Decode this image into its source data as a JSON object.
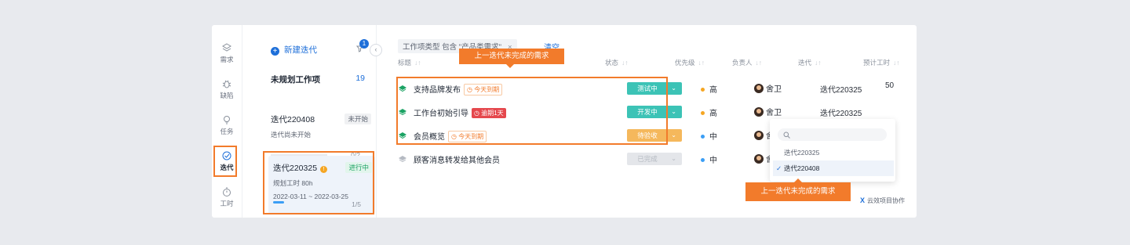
{
  "rail": [
    {
      "label": "需求",
      "icon": "layers-icon"
    },
    {
      "label": "缺陷",
      "icon": "bug-icon"
    },
    {
      "label": "任务",
      "icon": "lightbulb-icon"
    },
    {
      "label": "迭代",
      "icon": "iteration-icon",
      "active": true
    },
    {
      "label": "工时",
      "icon": "stopwatch-icon"
    }
  ],
  "iterations_panel": {
    "new_label": "新建迭代",
    "filter_badge": "1",
    "collapse_glyph": "‹",
    "unplanned_label": "未规划工作项",
    "unplanned_count": "19",
    "iter1": {
      "name": "迭代220408",
      "status": "未开始",
      "sub": "迭代尚未开始",
      "progress": "0/2"
    },
    "iter2": {
      "name": "迭代220325",
      "warn": "!",
      "status": "进行中",
      "hours": "规划工时 80h",
      "dates": "2022-03-11 ~ 2022-03-25",
      "progress": "1/5"
    }
  },
  "filter": {
    "chip": "工作项类型 包含 \"产品类需求\"",
    "chip_close": "×",
    "clear": "清空"
  },
  "columns": {
    "title": "标题",
    "status": "状态",
    "priority": "优先级",
    "owner": "负责人",
    "iteration": "迭代",
    "hours": "预计工时",
    "sort": "↓↑"
  },
  "rows": [
    {
      "title": "支持品牌发布",
      "tag": "今天到期",
      "tag_type": "today",
      "status": "测试中",
      "status_color": "#3cc3b6",
      "priority": "高",
      "priority_color": "#f5a623",
      "owner": "舍卫",
      "iteration": "迭代220325",
      "hours": "50"
    },
    {
      "title": "工作台初始引导",
      "tag": "逾期1天",
      "tag_type": "overdue",
      "status": "开发中",
      "status_color": "#3cc3b6",
      "priority": "高",
      "priority_color": "#f5a623",
      "owner": "舍卫",
      "iteration": "迭代220325",
      "hours": ""
    },
    {
      "title": "会员概览",
      "tag": "今天到期",
      "tag_type": "today",
      "status": "待验收",
      "status_color": "#f5b85c",
      "priority": "中",
      "priority_color": "#3b9ef5",
      "owner": "舍卫",
      "iteration": "",
      "hours": ""
    },
    {
      "title": "顾客消息转发给其他会员",
      "tag": "",
      "tag_type": "",
      "status": "已完成",
      "status_color": "#e4e6ea",
      "priority": "中",
      "priority_color": "#3b9ef5",
      "owner": "舍卫",
      "iteration": "",
      "hours": ""
    }
  ],
  "callouts": {
    "top": "上一迭代未完成的需求",
    "bottom": "上一迭代未完成的需求"
  },
  "dropdown": {
    "options": [
      "迭代220325",
      "迭代220408"
    ],
    "selected": "迭代220408",
    "check": "✓"
  },
  "brand": {
    "mark": "X",
    "text": "云效项目协作"
  },
  "colors": {
    "accent": "#1e6fd9",
    "highlight": "#f27b2b",
    "today_tag": "#f27b2b",
    "overdue_tag": "#e5484d"
  }
}
